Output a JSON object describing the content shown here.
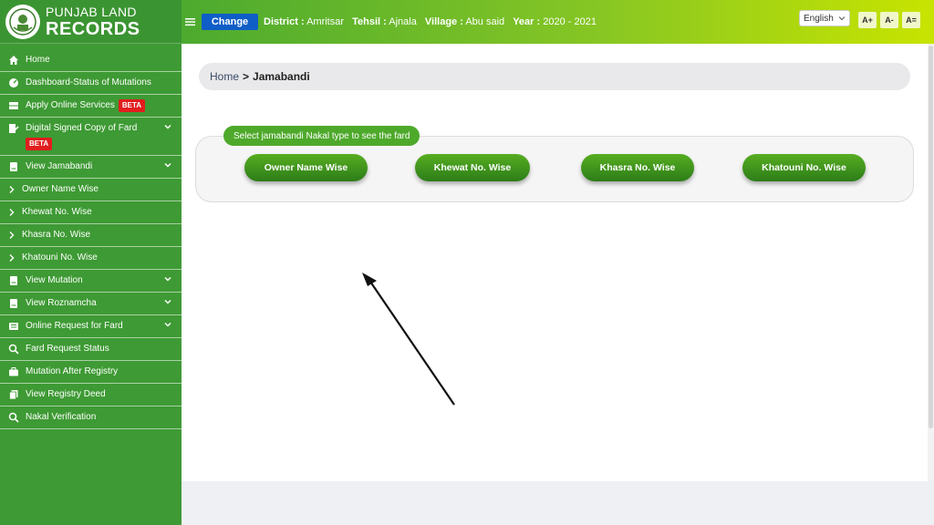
{
  "brand": {
    "line1": "PUNJAB LAND",
    "line2": "RECORDS"
  },
  "sidebar": {
    "items": [
      {
        "label": "Home",
        "icon": "home-icon"
      },
      {
        "label": "Dashboard-Status of Mutations",
        "icon": "dashboard-icon"
      },
      {
        "label": "Apply Online Services",
        "icon": "server-icon",
        "badge": "BETA"
      },
      {
        "label": "Digital Signed Copy of Fard",
        "icon": "signature-icon",
        "badge": "BETA"
      },
      {
        "label": "View Jamabandi",
        "icon": "book-icon"
      },
      {
        "label": "Owner Name Wise",
        "icon": "chevron-right-icon"
      },
      {
        "label": "Khewat No. Wise",
        "icon": "chevron-right-icon"
      },
      {
        "label": "Khasra No. Wise",
        "icon": "chevron-right-icon"
      },
      {
        "label": "Khatouni No. Wise",
        "icon": "chevron-right-icon"
      },
      {
        "label": "View Mutation",
        "icon": "book-icon"
      },
      {
        "label": "View Roznamcha",
        "icon": "book-icon"
      },
      {
        "label": "Online Request for Fard",
        "icon": "list-icon"
      },
      {
        "label": "Fard Request Status",
        "icon": "search-icon"
      },
      {
        "label": "Mutation After Registry",
        "icon": "briefcase-icon"
      },
      {
        "label": "View Registry Deed",
        "icon": "copy-icon"
      },
      {
        "label": "Nakal Verification",
        "icon": "search-icon"
      }
    ]
  },
  "header": {
    "change_label": "Change",
    "district_label": "District :",
    "district_value": "Amritsar",
    "tehsil_label": "Tehsil :",
    "tehsil_value": "Ajnala",
    "village_label": "Village :",
    "village_value": "Abu said",
    "year_label": "Year :",
    "year_value": "2020 - 2021",
    "language": "English",
    "font_increase": "A+",
    "font_decrease": "A-",
    "font_reset": "A="
  },
  "breadcrumb": {
    "home": "Home",
    "separator": ">",
    "current": "Jamabandi"
  },
  "panel": {
    "title": "Select jamabandi Nakal type to see the fard",
    "options": [
      "Owner Name Wise",
      "Khewat No. Wise",
      "Khasra No. Wise",
      "Khatouni No. Wise"
    ]
  },
  "colors": {
    "sidebar": "#3e9a34",
    "accent": "#0f5ec7",
    "badge": "#e11d1d",
    "button": "#2c7d18"
  }
}
